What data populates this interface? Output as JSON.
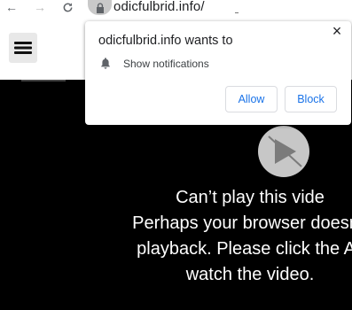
{
  "browser": {
    "url": "odicfulbrid.info/",
    "back_icon": "←",
    "forward_icon": "→",
    "reload_icon": "C"
  },
  "popup": {
    "title": "odicfulbrid.info wants to",
    "permission": "Show notifications",
    "allow_label": "Allow",
    "block_label": "Block",
    "close_label": "×"
  },
  "page": {
    "message_lines": [
      "Can’t play this vide",
      "Perhaps your browser doesn’t",
      "playback. Please click the All",
      "watch the video."
    ]
  },
  "colors": {
    "accent": "#1a73e8",
    "background": "#000000",
    "text": "#ffffff"
  }
}
